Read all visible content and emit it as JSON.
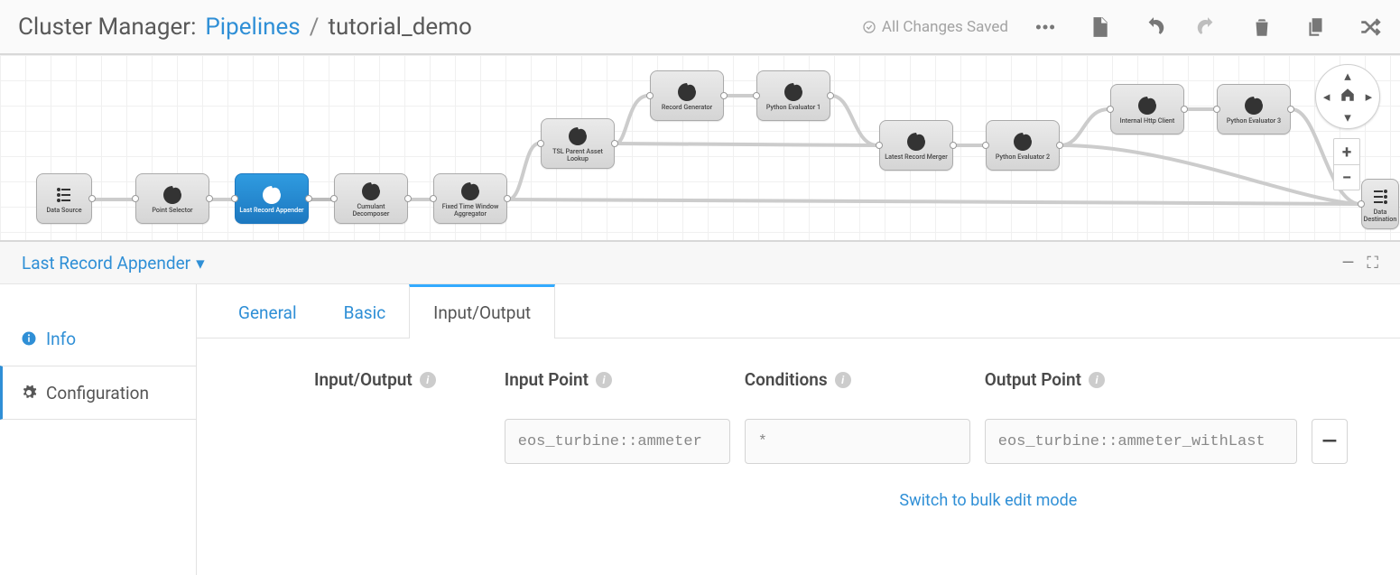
{
  "header": {
    "app_label": "Cluster Manager:",
    "link": "Pipelines",
    "sep": "/",
    "page": "tutorial_demo",
    "saved_label": "All Changes Saved"
  },
  "nodes": {
    "data_source": "Data Source",
    "point_selector": "Point Selector",
    "last_record_appender": "Last Record Appender",
    "cumulant_decomposer": "Cumulant Decomposer",
    "fixed_time_window": "Fixed Time Window Aggregator",
    "tsl_parent": "TSL Parent Asset Lookup",
    "record_generator": "Record Generator",
    "python_eval_1": "Python Evaluator 1",
    "latest_record_merger": "Latest Record Merger",
    "python_eval_2": "Python Evaluator 2",
    "internal_http_client": "Internal Http Client",
    "python_eval_3": "Python Evaluator 3",
    "data_destination": "Data Destination"
  },
  "node_panel": {
    "title": "Last Record Appender"
  },
  "sidetabs": {
    "info": "Info",
    "configuration": "Configuration"
  },
  "htabs": {
    "general": "General",
    "basic": "Basic",
    "io": "Input/Output"
  },
  "form": {
    "section": "Input/Output",
    "col_input": "Input Point",
    "col_cond": "Conditions",
    "col_output": "Output Point",
    "val_input": "eos_turbine::ammeter",
    "val_cond": "*",
    "val_output": "eos_turbine::ammeter_withLast",
    "bulk_link": "Switch to bulk edit mode"
  }
}
